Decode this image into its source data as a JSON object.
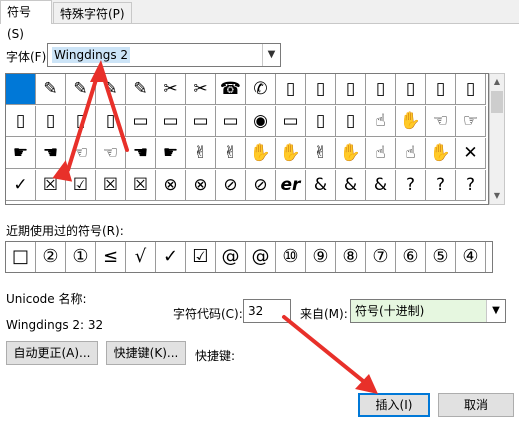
{
  "tabs": [
    {
      "label": "符号(S)"
    },
    {
      "label": "特殊字符(P)"
    }
  ],
  "font": {
    "label": "字体(F):",
    "value": "Wingdings 2"
  },
  "symbol_grid": {
    "rows": [
      [
        "■",
        "✎",
        "✎",
        "✎",
        "✎",
        "✂",
        "✂",
        "☎",
        "✆",
        "▯",
        "▯",
        "▯",
        "▯",
        "▯",
        "▯",
        "▯"
      ],
      [
        "▯",
        "▯",
        "▯",
        "▯",
        "▭",
        "▭",
        "▭",
        "▭",
        "◉",
        "▭",
        "▯",
        "▯",
        "☝",
        "✋",
        "☜",
        "☞"
      ],
      [
        "☛",
        "☚",
        "☜",
        "☜",
        "☚",
        "☛",
        "✌",
        "✌",
        "✋",
        "✋",
        "✌",
        "✋",
        "☝",
        "☝",
        "✋",
        "✕"
      ],
      [
        "✓",
        "☒",
        "☑",
        "☒",
        "☒",
        "⊗",
        "⊗",
        "⊘",
        "⊘",
        "er",
        "&",
        "&",
        "&",
        "?",
        "?",
        "?"
      ]
    ]
  },
  "recent": {
    "label": "近期使用过的符号(R):",
    "symbols": [
      "□",
      "②",
      "①",
      "≤",
      "√",
      "✓",
      "☑",
      "@",
      "@",
      "⑩",
      "⑨",
      "⑧",
      "⑦",
      "⑥",
      "⑤",
      "④"
    ]
  },
  "unicode": {
    "name_label": "Unicode 名称:",
    "name_value": "Wingdings 2: 32"
  },
  "char_code": {
    "label": "字符代码(C):",
    "value": "32"
  },
  "from": {
    "label": "来自(M):",
    "value": "符号(十进制)"
  },
  "buttons": {
    "autocorrect": "自动更正(A)...",
    "shortcut_key": "快捷键(K)...",
    "shortcut_label": "快捷键:",
    "insert": "插入(I)",
    "cancel": "取消"
  },
  "colors": {
    "accent": "#0078d7",
    "arrow": "#e8302a",
    "combo_bg": "#e6f7e0"
  }
}
